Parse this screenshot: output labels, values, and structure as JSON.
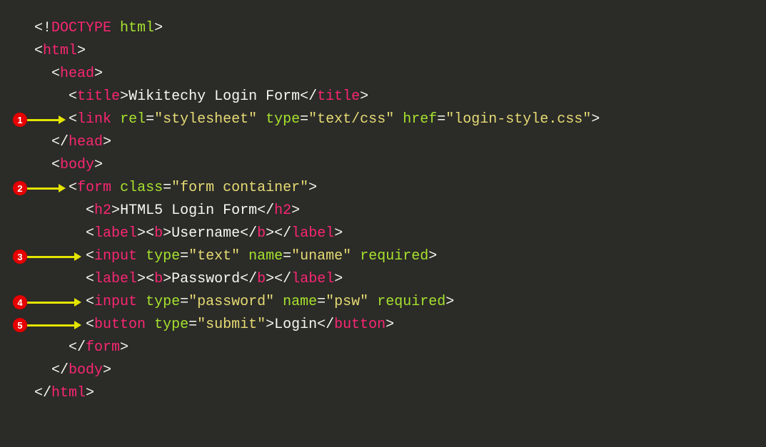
{
  "callouts": [
    {
      "num": "1",
      "line": 4,
      "indent": 2
    },
    {
      "num": "2",
      "line": 7,
      "indent": 2
    },
    {
      "num": "3",
      "line": 10,
      "indent": 3
    },
    {
      "num": "4",
      "line": 12,
      "indent": 3
    },
    {
      "num": "5",
      "line": 13,
      "indent": 3
    }
  ],
  "code": {
    "l0": {
      "t0": "<!",
      "t1": "DOCTYPE",
      "sp": " ",
      "t2": "html",
      "t3": ">"
    },
    "l1": {
      "t0": "<",
      "t1": "html",
      "t2": ">"
    },
    "l2": {
      "t0": "<",
      "t1": "head",
      "t2": ">"
    },
    "l3": {
      "t0": "<",
      "t1": "title",
      "t2": ">",
      "txt": "Wikitechy Login Form",
      "t3": "</",
      "t4": "title",
      "t5": ">"
    },
    "l4": {
      "t0": "<",
      "t1": "link",
      "sp": " ",
      "a1": "rel",
      "eq1": "=",
      "v1": "\"stylesheet\"",
      "sp2": " ",
      "a2": "type",
      "eq2": "=",
      "v2": "\"text/css\"",
      "sp3": " ",
      "a3": "href",
      "eq3": "=",
      "v3": "\"login-style.css\"",
      "t2": ">"
    },
    "l5": {
      "t0": "</",
      "t1": "head",
      "t2": ">"
    },
    "l6": {
      "t0": "<",
      "t1": "body",
      "t2": ">"
    },
    "l7": {
      "t0": "<",
      "t1": "form",
      "sp": " ",
      "a1": "class",
      "eq1": "=",
      "v1": "\"form container\"",
      "t2": ">"
    },
    "l8": {
      "t0": "<",
      "t1": "h2",
      "t2": ">",
      "txt": "HTML5 Login Form",
      "t3": "</",
      "t4": "h2",
      "t5": ">"
    },
    "l9": {
      "t0": "<",
      "t1": "label",
      "t2": ">",
      "b0": "<",
      "b1": "b",
      "b2": ">",
      "txt": "Username",
      "b3": "</",
      "b4": "b",
      "b5": ">",
      "t3": "</",
      "t4": "label",
      "t5": ">"
    },
    "l10": {
      "t0": "<",
      "t1": "input",
      "sp": " ",
      "a1": "type",
      "eq1": "=",
      "v1": "\"text\"",
      "sp2": " ",
      "a2": "name",
      "eq2": "=",
      "v2": "\"uname\"",
      "sp3": " ",
      "a3": "required",
      "t2": ">"
    },
    "l11": {
      "t0": "<",
      "t1": "label",
      "t2": ">",
      "b0": "<",
      "b1": "b",
      "b2": ">",
      "txt": "Password",
      "b3": "</",
      "b4": "b",
      "b5": ">",
      "t3": "</",
      "t4": "label",
      "t5": ">"
    },
    "l12": {
      "t0": "<",
      "t1": "input",
      "sp": " ",
      "a1": "type",
      "eq1": "=",
      "v1": "\"password\"",
      "sp2": " ",
      "a2": "name",
      "eq2": "=",
      "v2": "\"psw\"",
      "sp3": " ",
      "a3": "required",
      "t2": ">"
    },
    "l13": {
      "t0": "<",
      "t1": "button",
      "sp": " ",
      "a1": "type",
      "eq1": "=",
      "v1": "\"submit\"",
      "t2": ">",
      "txt": "Login",
      "t3": "</",
      "t4": "button",
      "t5": ">"
    },
    "l14": {
      "t0": "</",
      "t1": "form",
      "t2": ">"
    },
    "l15": {
      "t0": "</",
      "t1": "body",
      "t2": ">"
    },
    "l16": {
      "t0": "</",
      "t1": "html",
      "t2": ">"
    }
  },
  "layout": {
    "lineHeight": 32,
    "codeLeft": 48,
    "charWidth": 11,
    "indentUnit": 2,
    "calloutLeft": 18,
    "badgeSize": 20
  }
}
